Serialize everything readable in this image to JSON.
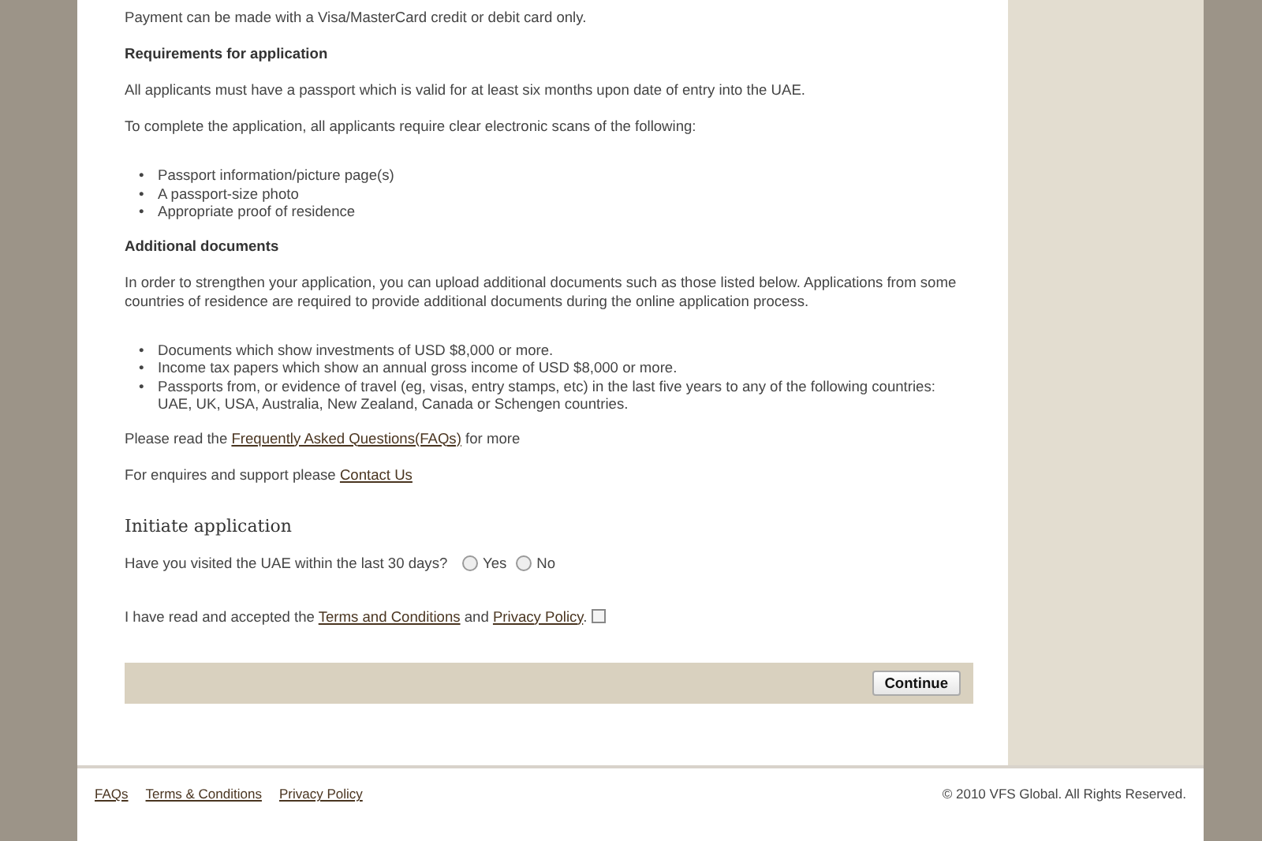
{
  "content": [
    {
      "kind": "text",
      "text": "Payment can be made with a Visa/MasterCard credit or debit card only."
    },
    {
      "kind": "heading",
      "text": "Requirements for application"
    },
    {
      "kind": "text",
      "text": "All applicants must have a passport which is valid for at least six months upon date of entry into the UAE."
    },
    {
      "kind": "text",
      "text": "To complete the application, all applicants require clear electronic scans of the following:"
    },
    {
      "kind": "bullets",
      "marker": "•",
      "items": [
        "Passport information/picture page(s)",
        "A passport-size photo",
        "Appropriate proof of residence"
      ]
    },
    {
      "kind": "heading",
      "text": "Additional documents"
    },
    {
      "kind": "text",
      "text": "In order to strengthen your application, you can upload additional documents such as those listed below. Applications from some countries of residence are required to provide additional documents during the online application process."
    },
    {
      "kind": "bullets",
      "marker": "•",
      "items": [
        "Documents which show investments of USD $8,000 or more.",
        "Income tax papers which show an annual gross income of USD $8,000 or more.",
        "Passports from, or evidence of travel (eg, visas, entry stamps, etc) in the last five years to any of the following countries: UAE, UK, USA, Australia, New Zealand, Canada or Schengen countries."
      ]
    },
    {
      "kind": "link_text",
      "before": "Please read the ",
      "link": "Frequently Asked Questions(FAQs)",
      "after": " for more"
    },
    {
      "kind": "link_text",
      "before": "For enquires and support please ",
      "link": "Contact Us"
    }
  ],
  "form": {
    "title": "Initiate application",
    "question": "Have you visited the UAE within the last 30 days?",
    "options": [
      {
        "label": "Yes",
        "selected": false
      },
      {
        "label": "No",
        "selected": false
      }
    ],
    "terms": {
      "before": "I have read and accepted the ",
      "link1": "Terms and Conditions",
      "middle": " and ",
      "link2": "Privacy Policy",
      "after": ".",
      "checked": false
    },
    "button": "Continue"
  },
  "footer": {
    "links": [
      "FAQs",
      "Terms & Conditions",
      "Privacy Policy"
    ],
    "copyright": "© 2010 VFS Global. All Rights Reserved."
  }
}
